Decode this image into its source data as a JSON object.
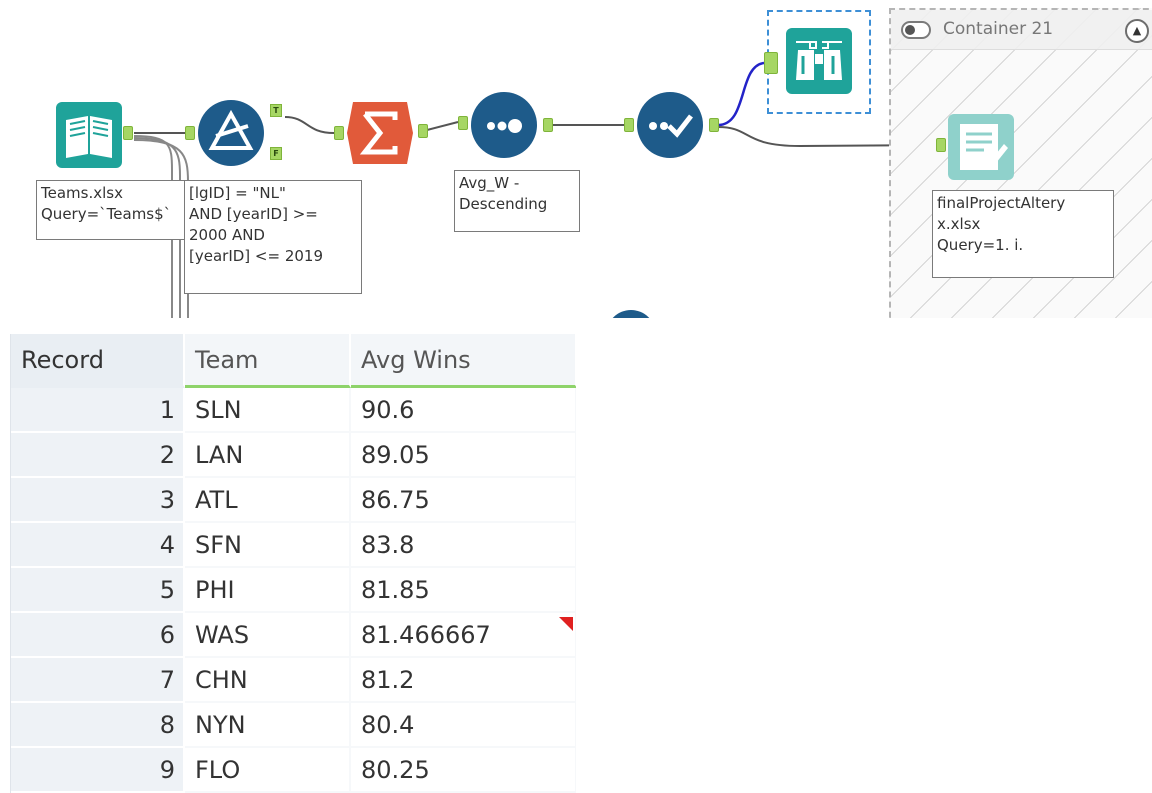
{
  "canvas": {
    "annotations": {
      "input": "Teams.xlsx\nQuery=`Teams$`",
      "filter": "[lgID] = \"NL\"\nAND [yearID] >=\n2000 AND\n[yearID] <= 2019",
      "sort": "Avg_W -\nDescending",
      "output": "finalProjectAltery\nx.xlsx\nQuery=1. i."
    },
    "filter_true_label": "T",
    "filter_false_label": "F",
    "container": {
      "title": "Container 21",
      "collapse_glyph": "▲"
    },
    "colors": {
      "input": "#1fa39a",
      "filter": "#1e5b8a",
      "summarize": "#e15a3a",
      "sample": "#1e5b8a",
      "select": "#1e5b8a",
      "browse": "#1fa39a",
      "output": "#8fd1cb",
      "anchor": "#a6d664",
      "selection": "#3d8fd6"
    }
  },
  "results": {
    "columns": [
      "Record",
      "Team",
      "Avg Wins"
    ],
    "rows": [
      {
        "record": "1",
        "team": "SLN",
        "avg": "90.6"
      },
      {
        "record": "2",
        "team": "LAN",
        "avg": "89.05"
      },
      {
        "record": "3",
        "team": "ATL",
        "avg": "86.75"
      },
      {
        "record": "4",
        "team": "SFN",
        "avg": "83.8"
      },
      {
        "record": "5",
        "team": "PHI",
        "avg": "81.85"
      },
      {
        "record": "6",
        "team": "WAS",
        "avg": "81.466667"
      },
      {
        "record": "7",
        "team": "CHN",
        "avg": "81.2"
      },
      {
        "record": "8",
        "team": "NYN",
        "avg": "80.4"
      },
      {
        "record": "9",
        "team": "FLO",
        "avg": "80.25"
      }
    ]
  }
}
